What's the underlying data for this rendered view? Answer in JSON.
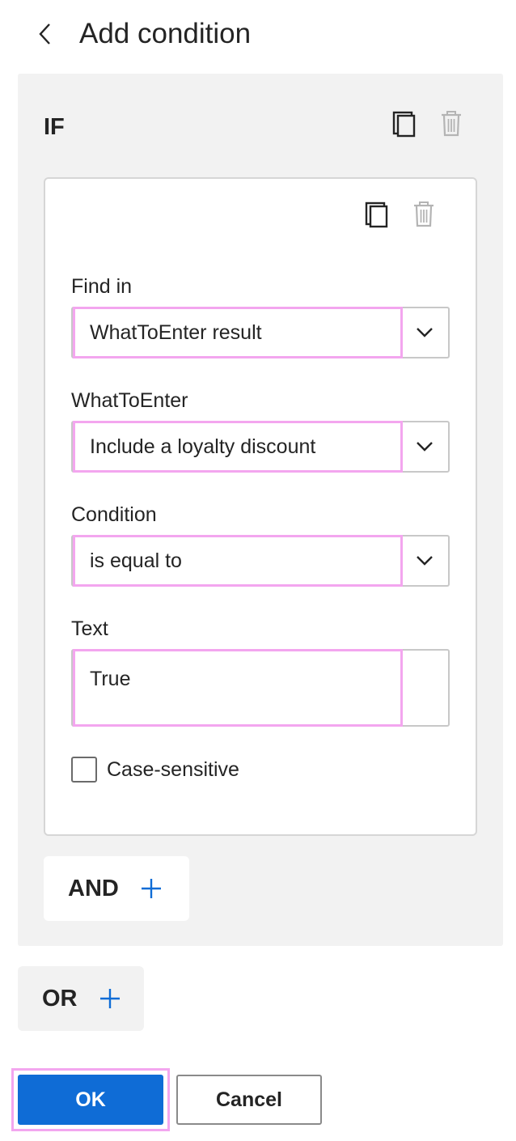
{
  "header": {
    "title": "Add condition",
    "back_icon": "chevron-left-icon"
  },
  "if_block": {
    "label": "IF",
    "copy_icon": "copy-icon",
    "delete_icon": "trash-icon"
  },
  "condition": {
    "copy_icon": "copy-icon",
    "delete_icon": "trash-icon",
    "find_in": {
      "label": "Find in",
      "value": "WhatToEnter result"
    },
    "what_to_enter": {
      "label": "WhatToEnter",
      "value": "Include a loyalty discount"
    },
    "condition": {
      "label": "Condition",
      "value": "is equal to"
    },
    "text": {
      "label": "Text",
      "value": "True"
    },
    "case_sensitive": {
      "label": "Case-sensitive",
      "checked": false
    }
  },
  "and_button": {
    "label": "AND",
    "icon": "plus-icon"
  },
  "or_button": {
    "label": "OR",
    "icon": "plus-icon"
  },
  "footer": {
    "ok_label": "OK",
    "cancel_label": "Cancel"
  },
  "colors": {
    "accent": "#0f6cd6",
    "highlight": "#f3a6ef",
    "panel": "#f2f2f2"
  }
}
